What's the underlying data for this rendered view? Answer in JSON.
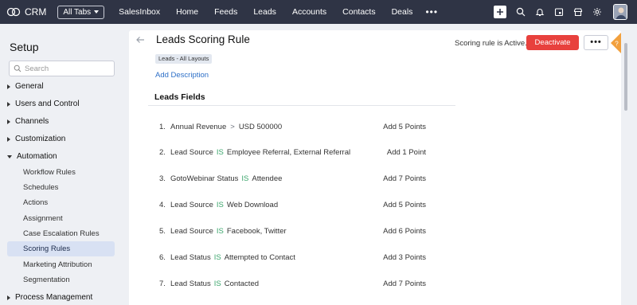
{
  "topbar": {
    "brand": "CRM",
    "all_tabs": "All Tabs",
    "nav": [
      "SalesInbox",
      "Home",
      "Feeds",
      "Leads",
      "Accounts",
      "Contacts",
      "Deals"
    ],
    "more": "•••"
  },
  "sidebar": {
    "title": "Setup",
    "search_placeholder": "Search",
    "sections": {
      "general": "General",
      "users": "Users and Control",
      "channels": "Channels",
      "customization": "Customization",
      "automation": "Automation",
      "process": "Process Management"
    },
    "automation_items": [
      "Workflow Rules",
      "Schedules",
      "Actions",
      "Assignment",
      "Case Escalation Rules",
      "Scoring Rules",
      "Marketing Attribution",
      "Segmentation"
    ],
    "active_item": "Scoring Rules"
  },
  "main": {
    "title": "Leads Scoring Rule",
    "layout_badge": "Leads - All Layouts",
    "add_description": "Add Description",
    "status_text": "Scoring rule is Active.",
    "deactivate_label": "Deactivate",
    "more_label": "•••",
    "help_label": "?",
    "section_title": "Leads Fields",
    "rules": [
      {
        "num": "1.",
        "field": "Annual Revenue",
        "op": ">",
        "value": "USD 500000",
        "points": "Add 5 Points"
      },
      {
        "num": "2.",
        "field": "Lead Source",
        "op": "IS",
        "value": "Employee Referral, External Referral",
        "points": "Add 1 Point"
      },
      {
        "num": "3.",
        "field": "GotoWebinar Status",
        "op": "IS",
        "value": "Attendee",
        "points": "Add 7 Points"
      },
      {
        "num": "4.",
        "field": "Lead Source",
        "op": "IS",
        "value": "Web Download",
        "points": "Add 5 Points"
      },
      {
        "num": "5.",
        "field": "Lead Source",
        "op": "IS",
        "value": "Facebook, Twitter",
        "points": "Add 6 Points"
      },
      {
        "num": "6.",
        "field": "Lead Status",
        "op": "IS",
        "value": "Attempted to Contact",
        "points": "Add 3 Points"
      },
      {
        "num": "7.",
        "field": "Lead Status",
        "op": "IS",
        "value": "Contacted",
        "points": "Add 7 Points"
      }
    ]
  },
  "colors": {
    "topbar": "#2f3445",
    "deactivate": "#e8413d",
    "operator": "#3aa56b",
    "link": "#2d6fc7",
    "active_item_bg": "#d8e1f3",
    "help_flag": "#f2a03d"
  }
}
